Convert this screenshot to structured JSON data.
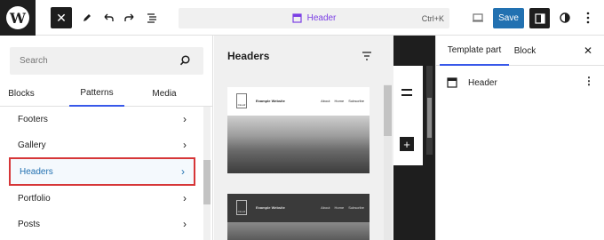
{
  "toolbar": {
    "close_icon": "close-icon",
    "document_title": "Header",
    "shortcut": "Ctrl+K",
    "save_label": "Save",
    "accent": "#2271b1"
  },
  "inserter": {
    "search_placeholder": "Search",
    "tabs": [
      "Blocks",
      "Patterns",
      "Media"
    ],
    "active_tab": "Patterns",
    "categories": [
      "Footers",
      "Gallery",
      "Headers",
      "Portfolio",
      "Posts"
    ],
    "selected_category": "Headers"
  },
  "patterns": {
    "title": "Headers",
    "cards": [
      {
        "site_name": "Example Website",
        "logo": "Cloudr",
        "links": [
          "About",
          "Home",
          "Subscribe"
        ]
      },
      {
        "site_name": "Example Website",
        "logo": "Cloudr",
        "links": [
          "About",
          "Home",
          "Subscribe"
        ]
      }
    ]
  },
  "settings": {
    "tabs": [
      "Template part",
      "Block"
    ],
    "active_tab": "Template part",
    "block_name": "Header"
  }
}
